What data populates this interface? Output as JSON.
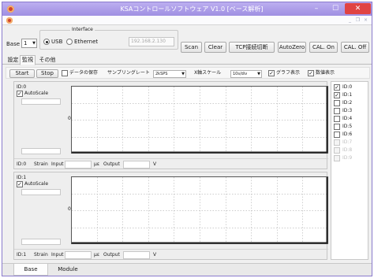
{
  "window": {
    "title": "KSAコントロールソフトウェア V1.0 [ベース解析]",
    "minimize": "–",
    "maximize": "☐",
    "close": "✕"
  },
  "mdi": {
    "minimize": "_",
    "restore": "❐",
    "close": "×"
  },
  "toolbar": {
    "base_id_label": "Base ID",
    "base_id_value": "1",
    "interface_label": "Interface",
    "usb_label": "USB",
    "ethernet_label": "Ethernet",
    "ip_address": "192.168.2.130",
    "selected_interface": "USB",
    "buttons": [
      "Scan",
      "Clear",
      "TCP接続切断",
      "AutoZero",
      "CAL. On",
      "CAL. Off"
    ]
  },
  "tabs": {
    "items": [
      "設定",
      "監視",
      "その他"
    ],
    "active": "監視"
  },
  "monitor_bar": {
    "start": "Start",
    "stop": "Stop",
    "save_data": "データの保存",
    "sampling_label": "サンプリングレート",
    "sampling_value": "2kSPS",
    "x_scale_label": "X軸スケール",
    "x_scale_value": "10s/div",
    "graph_display": "グラフ表示",
    "value_display": "数値表示"
  },
  "channels": [
    {
      "id_label": "ID:0",
      "autoscale": "AutoScale",
      "y_tick": "0",
      "footer_id": "ID:0",
      "footer_mode": "Strain",
      "input_label": "Input",
      "input_unit": "με",
      "output_label": "Output",
      "output_unit": "V"
    },
    {
      "id_label": "ID:1",
      "autoscale": "AutoScale",
      "y_tick": "0",
      "footer_id": "ID:1",
      "footer_mode": "Strain",
      "input_label": "Input",
      "input_unit": "με",
      "output_label": "Output",
      "output_unit": "V"
    }
  ],
  "id_list": [
    {
      "label": "ID:0",
      "checked": true,
      "enabled": true
    },
    {
      "label": "ID:1",
      "checked": true,
      "enabled": true
    },
    {
      "label": "ID:2",
      "checked": false,
      "enabled": true
    },
    {
      "label": "ID:3",
      "checked": false,
      "enabled": true
    },
    {
      "label": "ID:4",
      "checked": false,
      "enabled": true
    },
    {
      "label": "ID:5",
      "checked": false,
      "enabled": true
    },
    {
      "label": "ID:6",
      "checked": false,
      "enabled": true
    },
    {
      "label": "ID:7",
      "checked": false,
      "enabled": false
    },
    {
      "label": "ID:8",
      "checked": false,
      "enabled": false
    },
    {
      "label": "ID:9",
      "checked": false,
      "enabled": false
    }
  ],
  "bottom_tabs": {
    "items": [
      "Base",
      "Module"
    ],
    "active": "Base"
  },
  "colors": {
    "titlebar": "#a596e6",
    "close_button": "#e04343",
    "plot_grid": "#bdbdbd",
    "plot_axis": "#222222"
  }
}
